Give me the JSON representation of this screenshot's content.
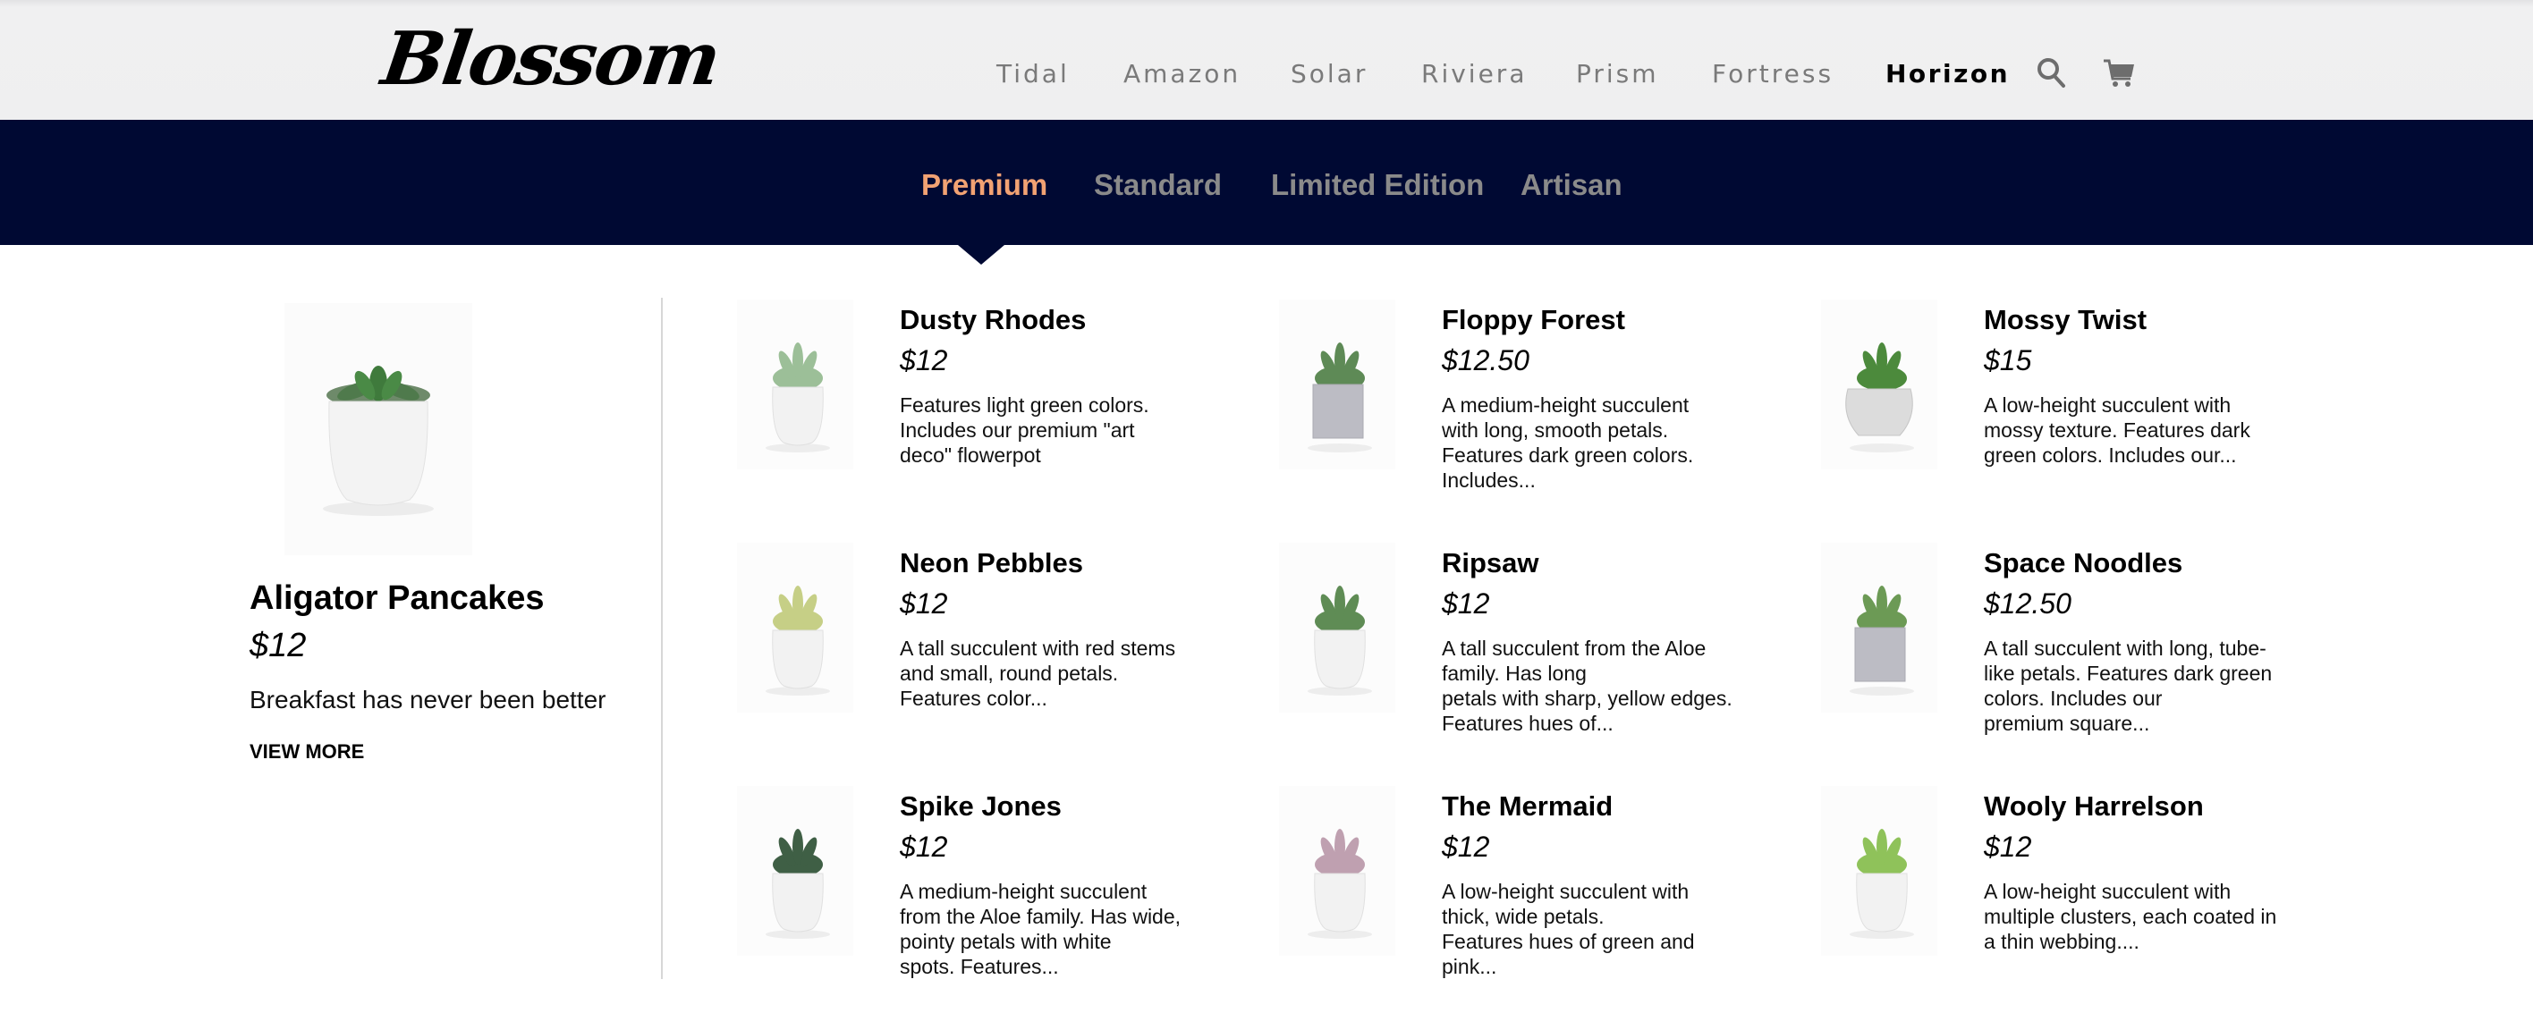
{
  "brand": {
    "logo_text": "Blossom"
  },
  "main_nav": {
    "items": [
      {
        "label": "Tidal",
        "active": false
      },
      {
        "label": "Amazon",
        "active": false
      },
      {
        "label": "Solar",
        "active": false
      },
      {
        "label": "Riviera",
        "active": false
      },
      {
        "label": "Prism",
        "active": false
      },
      {
        "label": "Fortress",
        "active": false
      },
      {
        "label": "Horizon",
        "active": true
      }
    ],
    "icons": [
      "search-icon",
      "cart-icon"
    ]
  },
  "category_nav": {
    "items": [
      {
        "label": "Premium",
        "active": true
      },
      {
        "label": "Standard",
        "active": false
      },
      {
        "label": "Limited Edition",
        "active": false
      },
      {
        "label": "Artisan",
        "active": false
      }
    ]
  },
  "featured": {
    "name": "Aligator Pancakes",
    "price": "$12",
    "tagline": "Breakfast has never been better",
    "cta": "VIEW MORE",
    "image": "succulent-rosette-white-pot"
  },
  "products": [
    {
      "name": "Dusty Rhodes",
      "price": "$12",
      "description": "Features light green colors.\nIncludes our premium \"art\ndeco\" flowerpot",
      "image": "light-green-rosette-white-pot"
    },
    {
      "name": "Floppy Forest",
      "price": "$12.50",
      "description": "A medium-height succulent\nwith long, smooth petals.\nFeatures dark green colors.\nIncludes...",
      "image": "floppy-leaves-gray-square-pot"
    },
    {
      "name": "Mossy Twist",
      "price": "$15",
      "description": "A low-height succulent with\nmossy texture. Features dark\ngreen colors. Includes our...",
      "image": "moss-twisted-concrete-pot"
    },
    {
      "name": "Neon Pebbles",
      "price": "$12",
      "description": "A tall succulent with red stems\nand small, round petals.\nFeatures color...",
      "image": "red-stem-succulent-white-pot"
    },
    {
      "name": "Ripsaw",
      "price": "$12",
      "description": "A tall succulent from the Aloe\nfamily. Has long\npetals with sharp, yellow edges.\nFeatures hues of...",
      "image": "aloe-yellow-edge-white-pot"
    },
    {
      "name": "Space Noodles",
      "price": "$12.50",
      "description": "A tall succulent with long, tube-\nlike petals. Features dark green\ncolors. Includes our\npremium square...",
      "image": "tube-petal-gray-square-pot"
    },
    {
      "name": "Spike Jones",
      "price": "$12",
      "description": "A medium-height succulent\nfrom the Aloe family. Has wide,\npointy petals with white\nspots. Features...",
      "image": "spiky-haworthia-white-pot"
    },
    {
      "name": "The Mermaid",
      "price": "$12",
      "description": "A low-height succulent with\nthick, wide petals.\nFeatures hues of green and\npink...",
      "image": "pink-echeveria-white-pot"
    },
    {
      "name": "Wooly Harrelson",
      "price": "$12",
      "description": "A low-height succulent with\nmultiple clusters, each coated in\na thin webbing....",
      "image": "cluster-succulent-white-pot"
    }
  ],
  "colors": {
    "header_bg": "#efeff0",
    "category_bar_bg": "#000933",
    "category_active": "#f2a273",
    "category_inactive": "#8a8a8a",
    "nav_inactive": "#7a7a7a",
    "nav_active": "#000000",
    "divider": "#d7d7d7"
  }
}
